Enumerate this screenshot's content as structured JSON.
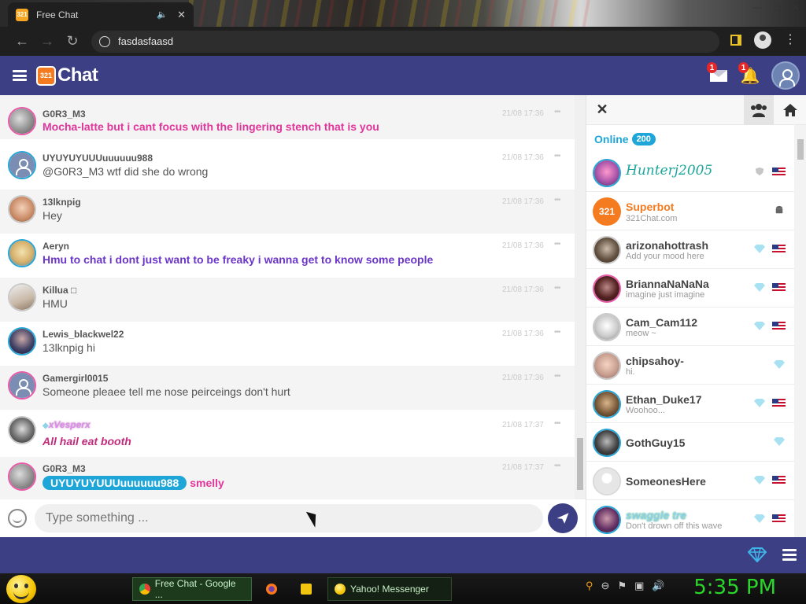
{
  "browser": {
    "tab_title": "Free Chat",
    "tab_favicon_text": "321",
    "address": "fasdasfaasd"
  },
  "app": {
    "logo_badge": "321",
    "logo_text": "Chat",
    "mail_badge": "1",
    "notif_badge": "1",
    "brand_color": "#3d3f84",
    "accent_color": "#1fa6d8"
  },
  "messages": [
    {
      "user": "G0R3_M3",
      "text": "Mocha-latte but i cant focus with the lingering stench that is you",
      "time": "21/08 17:36",
      "style": "pink"
    },
    {
      "user": "UYUYUYUUUuuuuuu988",
      "text": "@G0R3_M3 wtf did she do wrong",
      "time": "21/08 17:36",
      "style": "plain"
    },
    {
      "user": "13lknpig",
      "text": "Hey",
      "time": "21/08 17:36",
      "style": "plain"
    },
    {
      "user": "Aeryn",
      "text": "Hmu to chat i dont just want to be freaky i wanna get to know some people",
      "time": "21/08 17:36",
      "style": "purple"
    },
    {
      "user": "Killua □",
      "text": "HMU",
      "time": "21/08 17:36",
      "style": "plain"
    },
    {
      "user": "Lewis_blackwel22",
      "text": "13lknpig hi",
      "time": "21/08 17:36",
      "style": "plain"
    },
    {
      "user": "Gamergirl0015",
      "text": "Someone pleaee tell me nose peirceings don't hurt",
      "time": "21/08 17:36",
      "style": "plain"
    },
    {
      "user": "xVesperx",
      "text": "All hail eat booth",
      "time": "21/08 17:37",
      "style": "italic-pink"
    },
    {
      "user": "G0R3_M3",
      "mention": "UYUYUYUUUuuuuuu988",
      "text": "smelly",
      "time": "21/08 17:37",
      "style": "pink"
    }
  ],
  "input": {
    "placeholder": "Type something ..."
  },
  "panel": {
    "online_label": "Online",
    "online_count": "200",
    "users": [
      {
        "name": "Hunterj2005",
        "mood": ""
      },
      {
        "name": "Superbot",
        "mood": "321Chat.com"
      },
      {
        "name": "arizonahottrash",
        "mood": "Add your mood here"
      },
      {
        "name": "BriannaNaNaNa",
        "mood": "imagine just imagine"
      },
      {
        "name": "Cam_Cam112",
        "mood": "meow ~"
      },
      {
        "name": "chipsahoy-",
        "mood": "hi."
      },
      {
        "name": "Ethan_Duke17",
        "mood": "Woohoo..."
      },
      {
        "name": "GothGuy15",
        "mood": ""
      },
      {
        "name": "SomeonesHere",
        "mood": ""
      },
      {
        "name": "swaggle tre",
        "mood": "Don't drown off this wave"
      }
    ]
  },
  "taskbar": {
    "items": [
      "Free Chat - Google ...",
      "Yahoo! Messenger"
    ],
    "clock": "5:35 PM"
  }
}
